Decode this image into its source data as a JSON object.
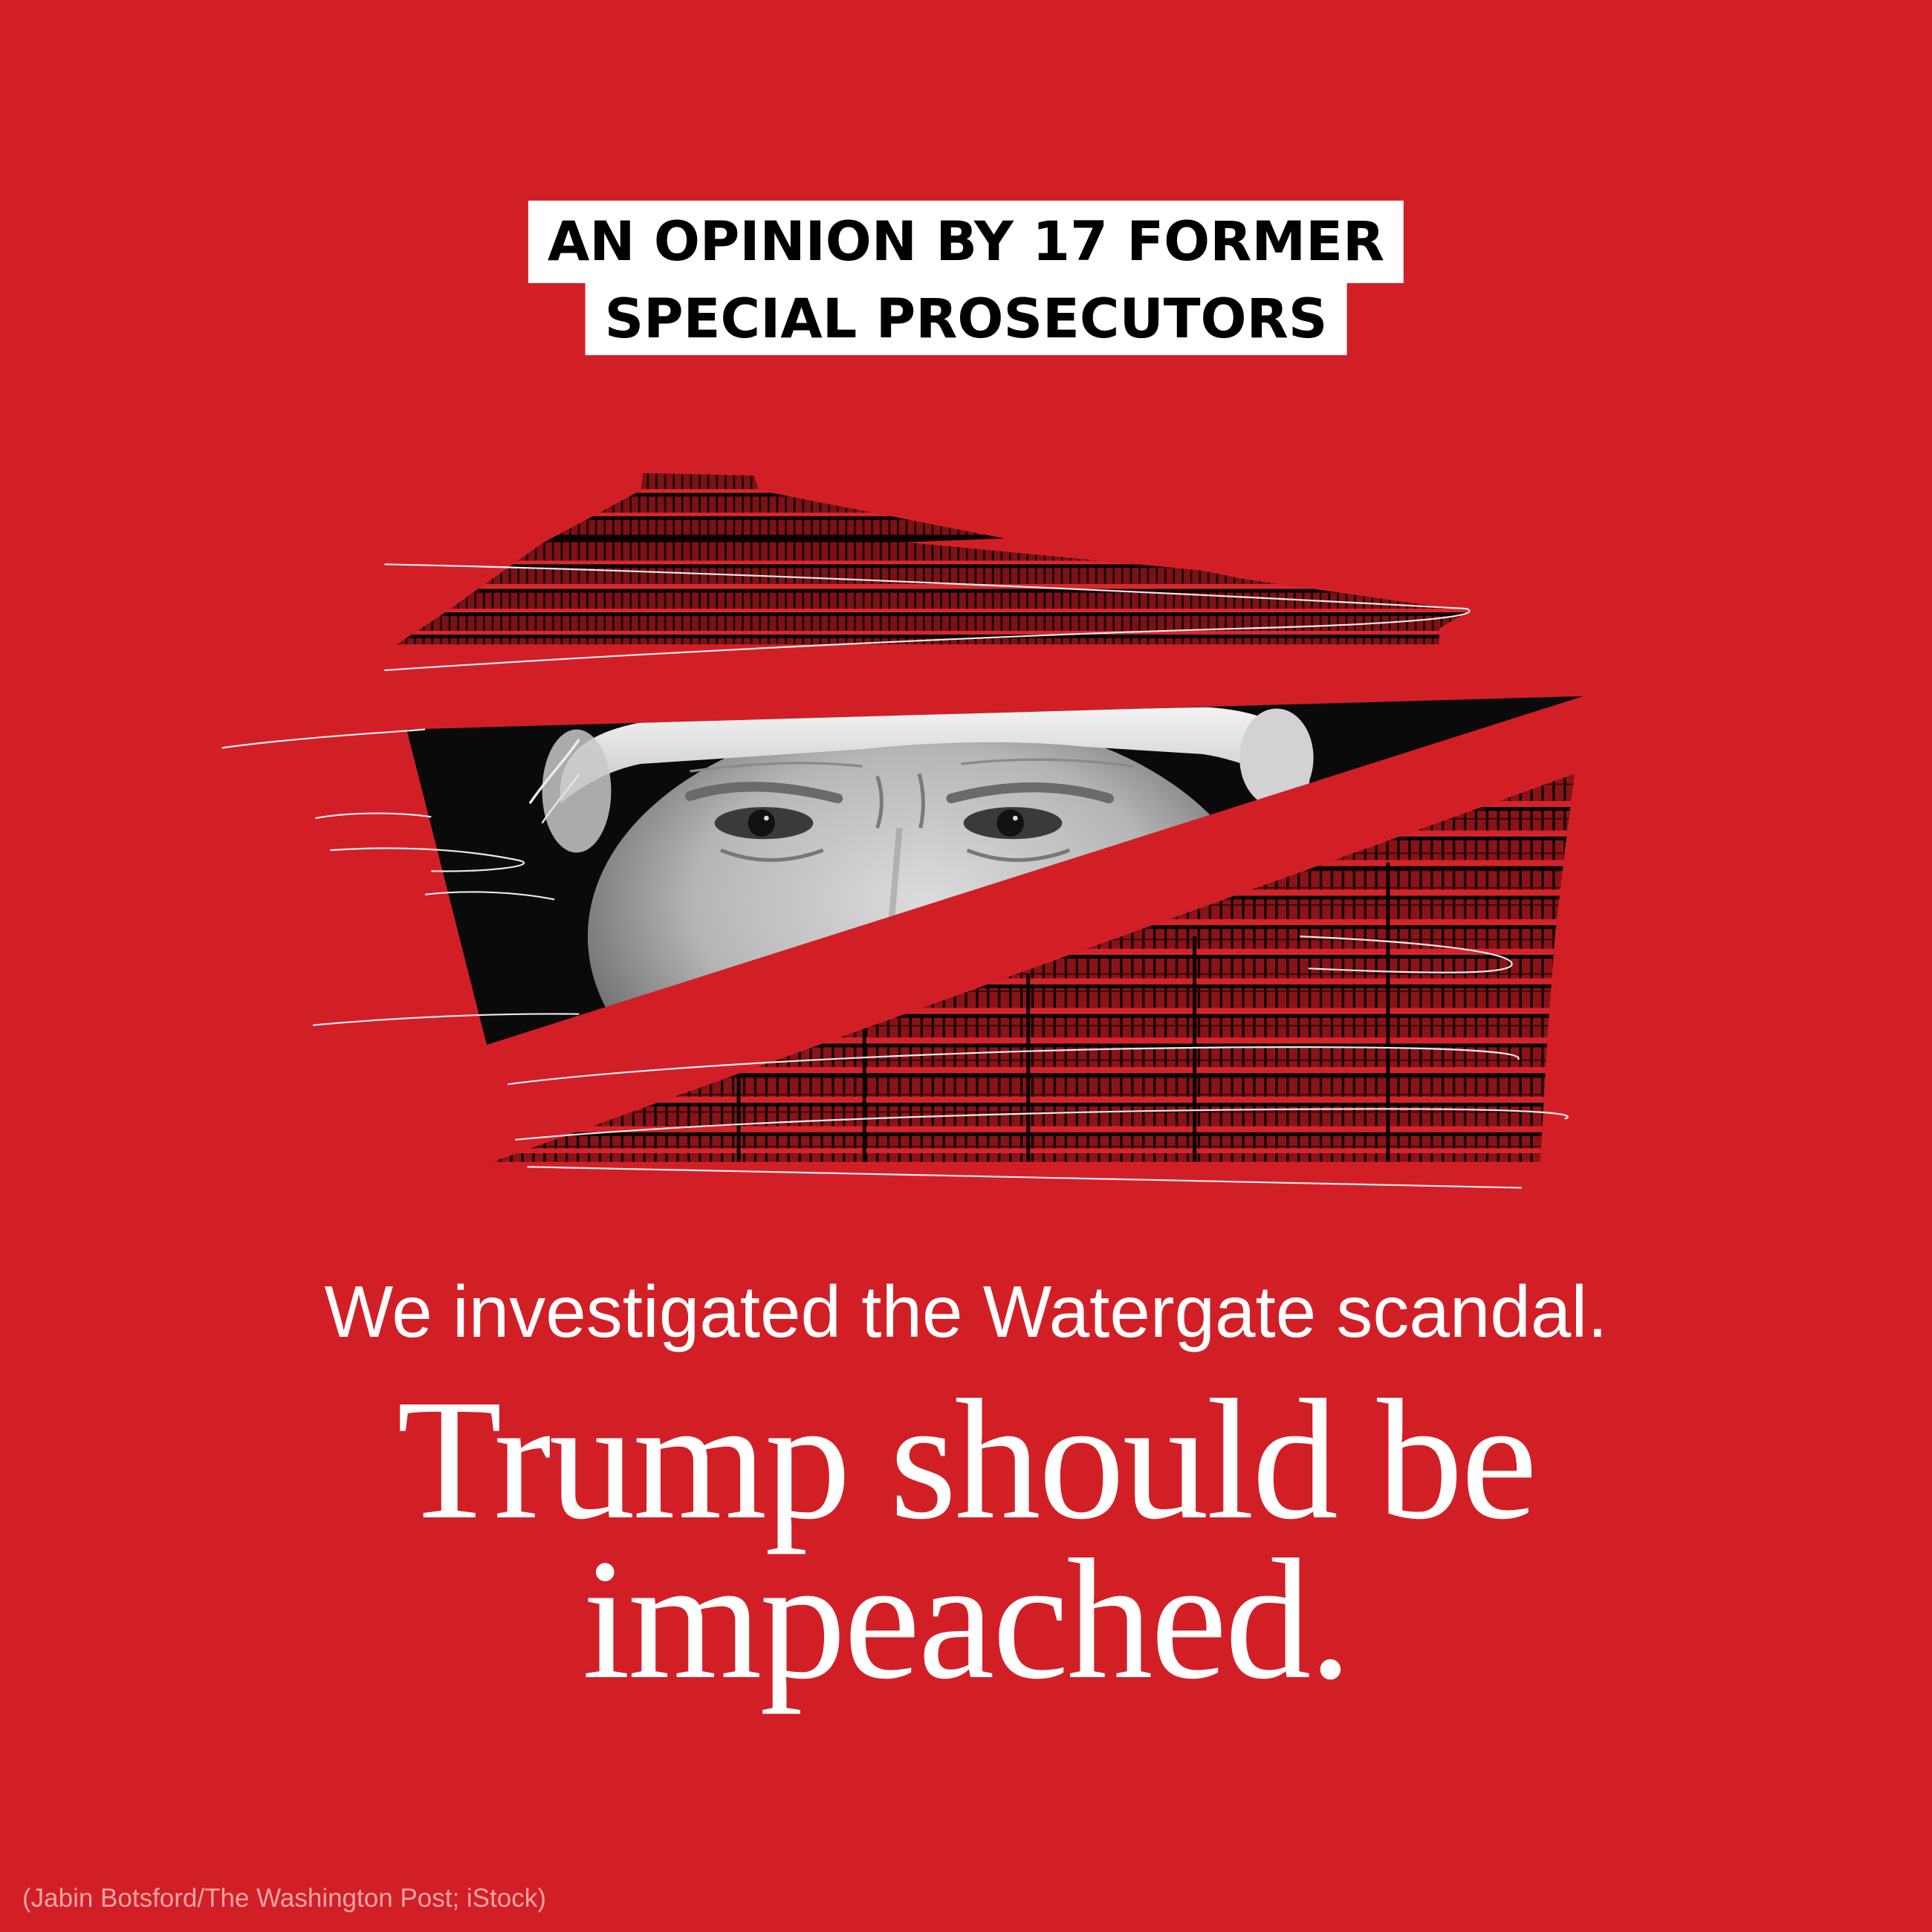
{
  "kicker": {
    "line1": "AN OPINION BY 17 FORMER",
    "line2": "SPECIAL PROSECUTORS"
  },
  "dek": "We investigated the Watergate scandal.",
  "headline": {
    "line1": "Trump should be",
    "line2": "impeached."
  },
  "credit": "(Jabin Botsford/The Washington Post; iStock)",
  "colors": {
    "background": "#D21F26",
    "text": "#FFFFFF",
    "kicker_background": "#FFFFFF",
    "kicker_text": "#000000",
    "credit": "#EDA4A6"
  }
}
